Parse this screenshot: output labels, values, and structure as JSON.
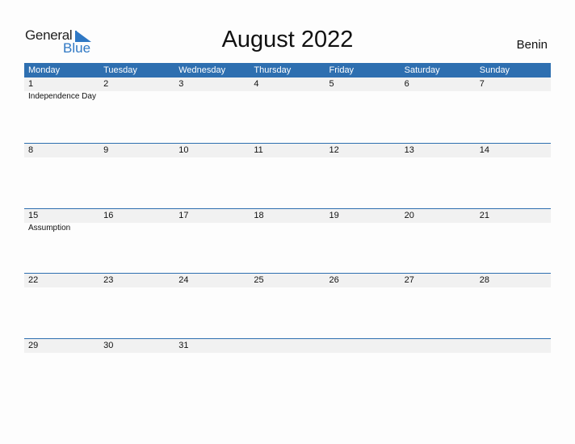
{
  "logo": {
    "word1": "General",
    "word2": "Blue"
  },
  "title": "August 2022",
  "country": "Benin",
  "colors": {
    "header": "#2e6fb0",
    "accent": "#2f78c4",
    "date_row": "#f1f1f1"
  },
  "weekdays": [
    "Monday",
    "Tuesday",
    "Wednesday",
    "Thursday",
    "Friday",
    "Saturday",
    "Sunday"
  ],
  "weeks": [
    {
      "days": [
        "1",
        "2",
        "3",
        "4",
        "5",
        "6",
        "7"
      ],
      "events": [
        "Independence Day",
        "",
        "",
        "",
        "",
        "",
        ""
      ]
    },
    {
      "days": [
        "8",
        "9",
        "10",
        "11",
        "12",
        "13",
        "14"
      ],
      "events": [
        "",
        "",
        "",
        "",
        "",
        "",
        ""
      ]
    },
    {
      "days": [
        "15",
        "16",
        "17",
        "18",
        "19",
        "20",
        "21"
      ],
      "events": [
        "Assumption",
        "",
        "",
        "",
        "",
        "",
        ""
      ]
    },
    {
      "days": [
        "22",
        "23",
        "24",
        "25",
        "26",
        "27",
        "28"
      ],
      "events": [
        "",
        "",
        "",
        "",
        "",
        "",
        ""
      ]
    },
    {
      "days": [
        "29",
        "30",
        "31",
        "",
        "",
        "",
        ""
      ],
      "events": [
        "",
        "",
        "",
        "",
        "",
        "",
        ""
      ]
    }
  ]
}
